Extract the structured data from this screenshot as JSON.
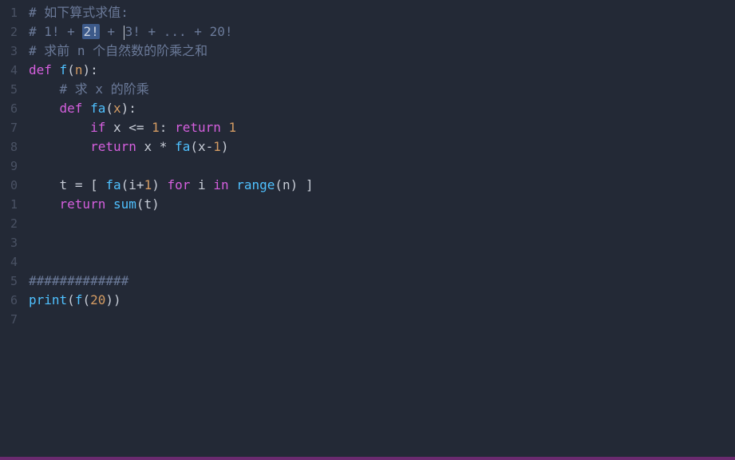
{
  "gutter": {
    "lines": [
      "1",
      "2",
      "3",
      "4",
      "5",
      "6",
      "7",
      "8",
      "9",
      "0",
      "1",
      "2",
      "3",
      "4",
      "5",
      "6",
      "7"
    ]
  },
  "code": {
    "l1_text": "# 如下算式求值:",
    "l2_pre": "# 1! + ",
    "l2_sel": "2!",
    "l2_mid": " + ",
    "l2_3ex": "3!",
    "l2_rest": " + ... + 20!",
    "l3_text": "# 求前 n 个自然数的阶乘之和",
    "l4_def": "def",
    "l4_fname": "f",
    "l4_open": "(",
    "l4_param": "n",
    "l4_close": ")",
    "l4_colon": ":",
    "l5_text": "# 求 x 的阶乘",
    "l6_def": "def",
    "l6_fname": "fa",
    "l6_open": "(",
    "l6_param": "x",
    "l6_close": ")",
    "l6_colon": ":",
    "l7_if": "if",
    "l7_x": "x",
    "l7_le": "<=",
    "l7_1": "1",
    "l7_colon": ":",
    "l7_ret": "return",
    "l7_1b": "1",
    "l8_ret": "return",
    "l8_x": "x",
    "l8_mul": "*",
    "l8_fa": "fa",
    "l8_open": "(",
    "l8_xm": "x",
    "l8_minus": "-",
    "l8_1": "1",
    "l8_close": ")",
    "l10_t": "t",
    "l10_eq": "=",
    "l10_lb": "[",
    "l10_fa": "fa",
    "l10_open": "(",
    "l10_i": "i",
    "l10_plus": "+",
    "l10_1": "1",
    "l10_close": ")",
    "l10_for": "for",
    "l10_i2": "i",
    "l10_in": "in",
    "l10_range": "range",
    "l10_open2": "(",
    "l10_n": "n",
    "l10_close2": ")",
    "l10_rb": "]",
    "l11_ret": "return",
    "l11_sum": "sum",
    "l11_open": "(",
    "l11_t": "t",
    "l11_close": ")",
    "l15_text": "#############",
    "l16_print": "print",
    "l16_open": "(",
    "l16_f": "f",
    "l16_open2": "(",
    "l16_20": "20",
    "l16_close2": ")",
    "l16_close": ")"
  }
}
